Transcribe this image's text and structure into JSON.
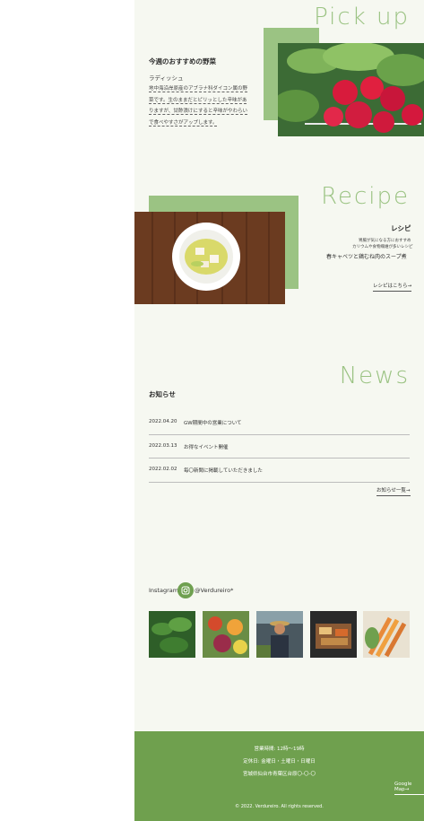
{
  "pickup": {
    "heading": "Pick up",
    "title": "今週のおすすめの野菜",
    "item_name": "ラディッシュ",
    "description": "地中海沿岸原産のアブラナ科ダイコン属の野菜です。生のままだとピリッとした辛味がありますが、甘酢漬けにすると辛味がやわらいで食べやすさがアップします。"
  },
  "recipe": {
    "heading": "Recipe",
    "title": "レシピ",
    "intro_line1": "胃腸が気になる方におすすめ",
    "intro_line2": "カリウムや食物繊維が多いレシピ",
    "dish": "春キャベツと鶏むね肉のスープ煮",
    "link": "レシピはこちら→"
  },
  "news": {
    "heading": "News",
    "title": "お知らせ",
    "items": [
      {
        "date": "2022.04.20",
        "title": "GW期間中の営業について"
      },
      {
        "date": "2022.03.13",
        "title": "お得なイベント開催"
      },
      {
        "date": "2022.02.02",
        "title": "毎〇新聞に掲載していただきました"
      }
    ],
    "more": "お知らせ一覧→"
  },
  "instagram": {
    "label": "Instagram",
    "handle": "@Verdureiro*"
  },
  "footer": {
    "hours": "営業時間: 12時〜19時",
    "closed": "定休日: 金曜日・土曜日・日曜日",
    "address": "宮城県仙台市青葉区台原〇-〇-〇",
    "map_link": "Google Map→",
    "copyright": "© 2022. Verdureiro. All rights reserved."
  },
  "colors": {
    "accent": "#9bc383",
    "footer": "#6fa04e",
    "background": "#f6f8f1"
  }
}
